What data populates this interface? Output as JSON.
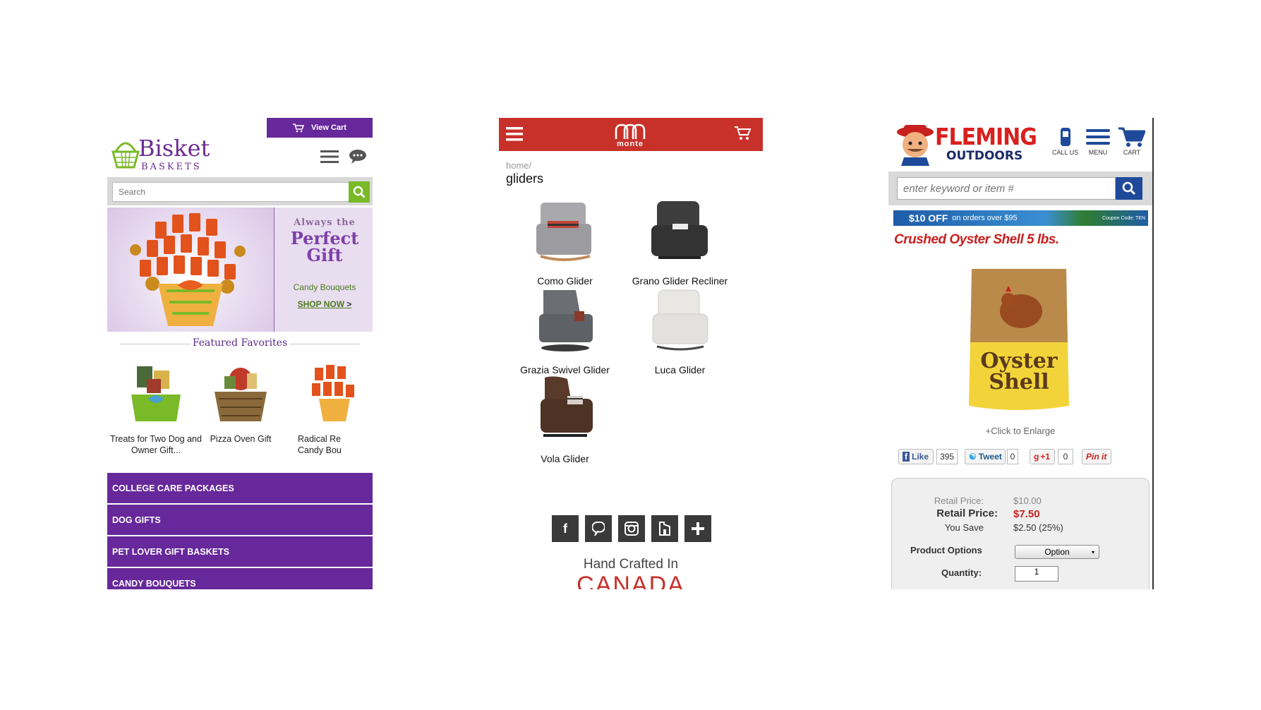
{
  "bisket": {
    "view_cart": "View Cart",
    "logo_word1": "Bisket",
    "logo_word2": "BASKETS",
    "search_placeholder": "Search",
    "hero": {
      "line1": "Always the",
      "line2": "Perfect Gift",
      "line3": "Candy Bouquets",
      "cta": "SHOP NOW",
      "cta_suffix": ">"
    },
    "featured_title": "Featured Favorites",
    "products": [
      {
        "name": "Treats for Two Dog and Owner Gift..."
      },
      {
        "name": "Pizza Oven Gift"
      },
      {
        "name": "Radical Re Candy Bou"
      }
    ],
    "categories": [
      "COLLEGE CARE PACKAGES",
      "DOG GIFTS",
      "PET LOVER GIFT BASKETS",
      "CANDY BOUQUETS"
    ],
    "colors": {
      "purple": "#66289a",
      "green": "#7ab928"
    }
  },
  "monte": {
    "brand": "monte",
    "breadcrumb": "home/",
    "heading": "gliders",
    "products": [
      {
        "name": "Como Glider",
        "color": "#a9a9ad"
      },
      {
        "name": "Grano Glider Recliner",
        "color": "#3d3d3d"
      },
      {
        "name": "Grazia Swivel Glider",
        "color": "#6b6e72"
      },
      {
        "name": "Luca Glider",
        "color": "#e9e7e3"
      },
      {
        "name": "Vola Glider",
        "color": "#5a3a2a"
      }
    ],
    "social_icons": [
      "facebook-icon",
      "pinterest-icon",
      "instagram-icon",
      "houzz-icon",
      "plus-icon"
    ],
    "crafted": "Hand Crafted In",
    "country": "CANADA",
    "colors": {
      "red": "#c8302a"
    }
  },
  "fleming": {
    "logo_word1": "FLEMING",
    "logo_word2": "OUTDOORS",
    "header_icons": [
      {
        "label": "CALL US",
        "icon": "phone-icon"
      },
      {
        "label": "MENU",
        "icon": "menu-icon"
      },
      {
        "label": "CART",
        "icon": "cart-icon"
      }
    ],
    "search_placeholder": "enter keyword or item #",
    "promo": {
      "amount": "$10 OFF",
      "text": "on orders over $95",
      "code": "Coupon Code: TEN"
    },
    "title": "Crushed Oyster Shell 5 lbs.",
    "bag_text1": "Oyster",
    "bag_text2": "Shell",
    "enlarge": "+Click to Enlarge",
    "shares": {
      "like": "Like",
      "like_count": "395",
      "tweet": "Tweet",
      "tweet_count": "0",
      "plus": "+1",
      "plus_count": "0",
      "pin": "Pin it"
    },
    "price": {
      "retail_label": "Retail Price:",
      "retail_value": "$10.00",
      "sale_label": "Retail Price:",
      "sale_value": "$7.50",
      "save_label": "You Save",
      "save_value": "$2.50 (25%)",
      "options_label": "Product Options",
      "options_value": "Option",
      "qty_label": "Quantity:",
      "qty_value": "1"
    },
    "colors": {
      "red": "#c8201e",
      "navy": "#1f4a9a"
    }
  }
}
